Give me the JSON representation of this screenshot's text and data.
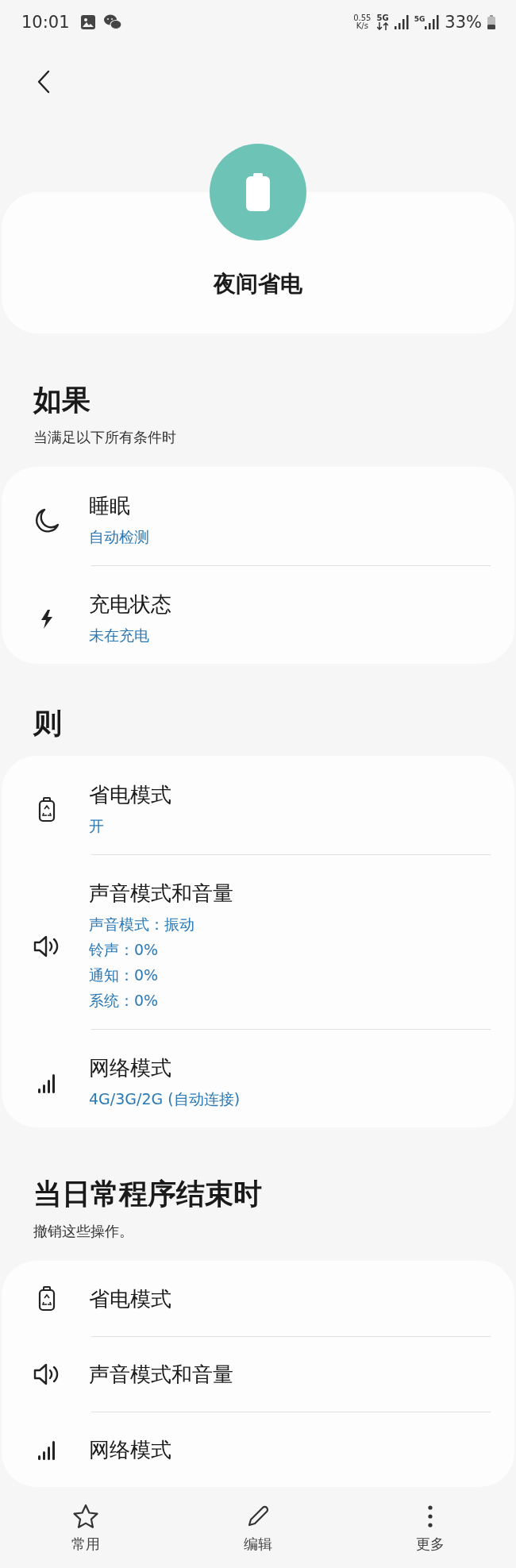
{
  "status_bar": {
    "time": "10:01",
    "net_speed": {
      "value": "0.55",
      "unit": "K/s"
    },
    "sim1_network": "5G",
    "sim2_network": "5G",
    "battery": "33%"
  },
  "header": {
    "title": "夜间省电"
  },
  "sections": [
    {
      "heading": "如果",
      "subheading": "当满足以下所有条件时",
      "items": [
        {
          "kind": "moon",
          "title": "睡眠",
          "details": [
            "自动检测"
          ]
        },
        {
          "kind": "bolt",
          "title": "充电状态",
          "details": [
            "未在充电"
          ]
        }
      ]
    },
    {
      "heading": "则",
      "items": [
        {
          "kind": "battery",
          "title": "省电模式",
          "details": [
            "开"
          ]
        },
        {
          "kind": "speaker",
          "title": "声音模式和音量",
          "details": [
            "声音模式：振动",
            "铃声：0%",
            "通知：0%",
            "系统：0%"
          ]
        },
        {
          "kind": "signal",
          "title": "网络模式",
          "details": [
            "4G/3G/2G (自动连接)"
          ]
        }
      ]
    },
    {
      "heading": "当日常程序结束时",
      "subheading": "撤销这些操作。",
      "items": [
        {
          "kind": "battery",
          "title": "省电模式"
        },
        {
          "kind": "speaker",
          "title": "声音模式和音量"
        },
        {
          "kind": "signal",
          "title": "网络模式"
        }
      ]
    }
  ],
  "bottom_nav": [
    {
      "kind": "star",
      "label": "常用"
    },
    {
      "kind": "pencil",
      "label": "编辑"
    },
    {
      "kind": "dots",
      "label": "更多"
    }
  ]
}
